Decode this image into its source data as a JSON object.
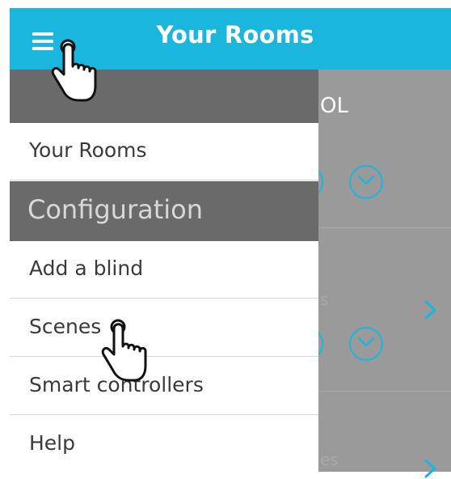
{
  "appbar": {
    "title": "Your Rooms",
    "menu_icon": "hamburger-menu-icon",
    "color": "#1ab6dd"
  },
  "drawer": {
    "items": [
      {
        "label": "Your Rooms"
      },
      {
        "label": "Add a blind"
      },
      {
        "label": "Scenes"
      },
      {
        "label": "Smart controllers"
      },
      {
        "label": "Help"
      }
    ],
    "section_label": "Configuration"
  },
  "background": {
    "partial_title": "OL",
    "faint_text_1": "s",
    "faint_text_2": "es"
  },
  "cursors": {
    "icon": "pointing-hand-cursor-icon"
  }
}
